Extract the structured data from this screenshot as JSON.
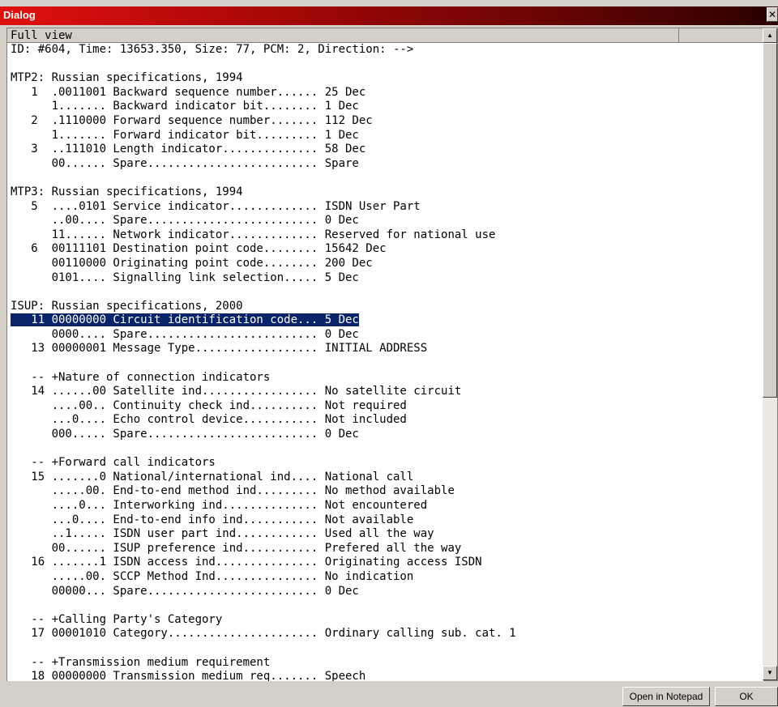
{
  "window": {
    "title": "Dialog",
    "close_glyph": "✕"
  },
  "header": {
    "label": "Full view"
  },
  "lines": [
    "ID: #604, Time: 13653.350, Size: 77, PCM: 2, Direction: -->",
    "",
    "MTP2: Russian specifications, 1994",
    "   1  .0011001 Backward sequence number...... 25 Dec",
    "      1....... Backward indicator bit........ 1 Dec",
    "   2  .1110000 Forward sequence number....... 112 Dec",
    "      1....... Forward indicator bit......... 1 Dec",
    "   3  ..111010 Length indicator.............. 58 Dec",
    "      00...... Spare......................... Spare",
    "",
    "MTP3: Russian specifications, 1994",
    "   5  ....0101 Service indicator............. ISDN User Part",
    "      ..00.... Spare......................... 0 Dec",
    "      11...... Network indicator............. Reserved for national use",
    "   6  00111101 Destination point code........ 15642 Dec",
    "      00110000 Originating point code........ 200 Dec",
    "      0101.... Signalling link selection..... 5 Dec",
    "",
    "ISUP: Russian specifications, 2000",
    "   11 00000000 Circuit identification code... 5 Dec",
    "      0000.... Spare......................... 0 Dec",
    "   13 00000001 Message Type.................. INITIAL ADDRESS",
    "",
    "   -- +Nature of connection indicators",
    "   14 ......00 Satellite ind................. No satellite circuit",
    "      ....00.. Continuity check ind.......... Not required",
    "      ...0.... Echo control device........... Not included",
    "      000..... Spare......................... 0 Dec",
    "",
    "   -- +Forward call indicators",
    "   15 .......0 National/international ind.... National call",
    "      .....00. End-to-end method ind......... No method available",
    "      ....0... Interworking ind.............. Not encountered",
    "      ...0.... End-to-end info ind........... Not available",
    "      ..1..... ISDN user part ind............ Used all the way",
    "      00...... ISUP preference ind........... Prefered all the way",
    "   16 .......1 ISDN access ind............... Originating access ISDN",
    "      .....00. SCCP Method Ind............... No indication",
    "      00000... Spare......................... 0 Dec",
    "",
    "   -- +Calling Party's Category",
    "   17 00001010 Category...................... Ordinary calling sub. cat. 1",
    "",
    "   -- +Transmission medium requirement",
    "   18 00000000 Transmission medium req....... Speech"
  ],
  "highlighted_line_index": 19,
  "scrollbar": {
    "up_glyph": "▲",
    "down_glyph": "▼"
  },
  "buttons": {
    "open_notepad": "Open in Notepad",
    "ok": "OK"
  }
}
